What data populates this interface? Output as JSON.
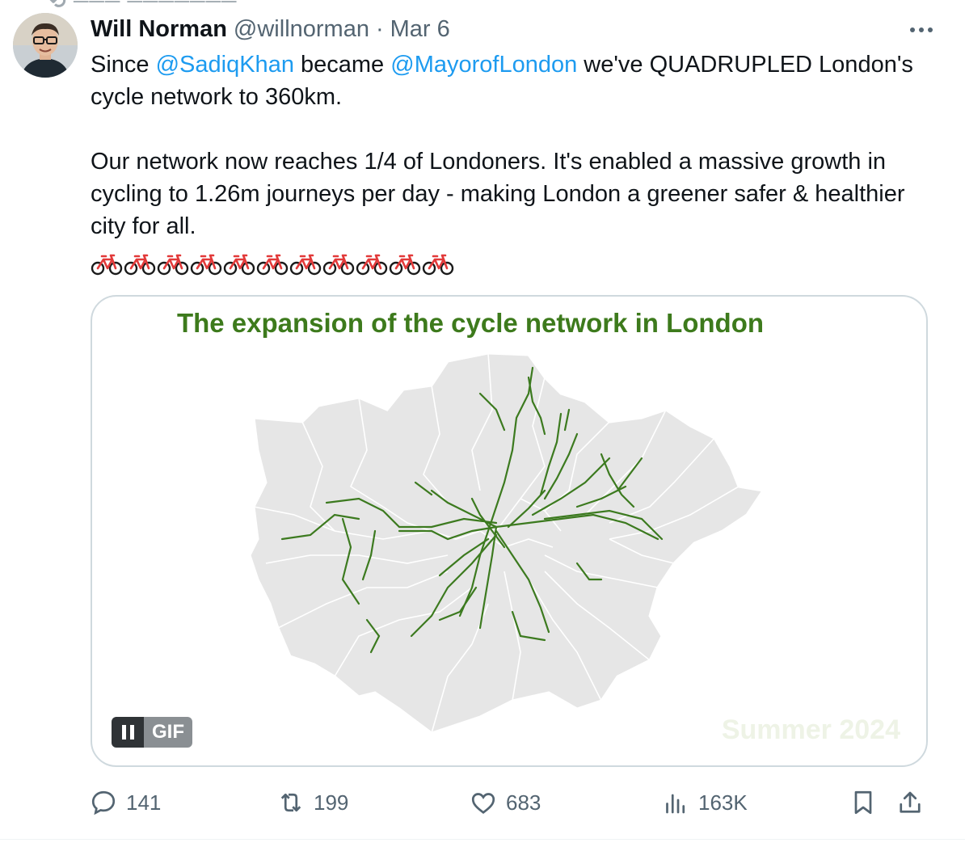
{
  "topline": "···· ········· ·······",
  "author": {
    "name": "Will Norman",
    "handle": "@willnorman",
    "separator": "·",
    "date": "Mar 6"
  },
  "tweet": {
    "p1_part1": "Since ",
    "mention1": "@SadiqKhan",
    "p1_part2": " became ",
    "mention2": "@MayorofLondon",
    "p1_part3": " we've QUADRUPLED London's cycle network to 360km.",
    "p2": "Our network now reaches 1/4 of Londoners. It's enabled a massive growth in cycling to 1.26m journeys per day - making London a greener safer & healthier city for all.",
    "bike_emoji_count": 11
  },
  "media": {
    "title": "The expansion of the cycle network in London",
    "watermark": "Summer 2024",
    "gif_label": "GIF"
  },
  "actions": {
    "replies": "141",
    "reposts": "199",
    "likes": "683",
    "views": "163K"
  },
  "colors": {
    "mention": "#1d9bf0",
    "map_title": "#3d7a1c",
    "cycle_routes": "#3c7a1f",
    "boroughs": "#e6e6e6",
    "muted_text": "#536471"
  },
  "icons": [
    "more-icon",
    "bicycle-icon",
    "pause-icon",
    "reply-icon",
    "repost-icon",
    "like-icon",
    "views-icon",
    "bookmark-icon",
    "share-icon"
  ]
}
